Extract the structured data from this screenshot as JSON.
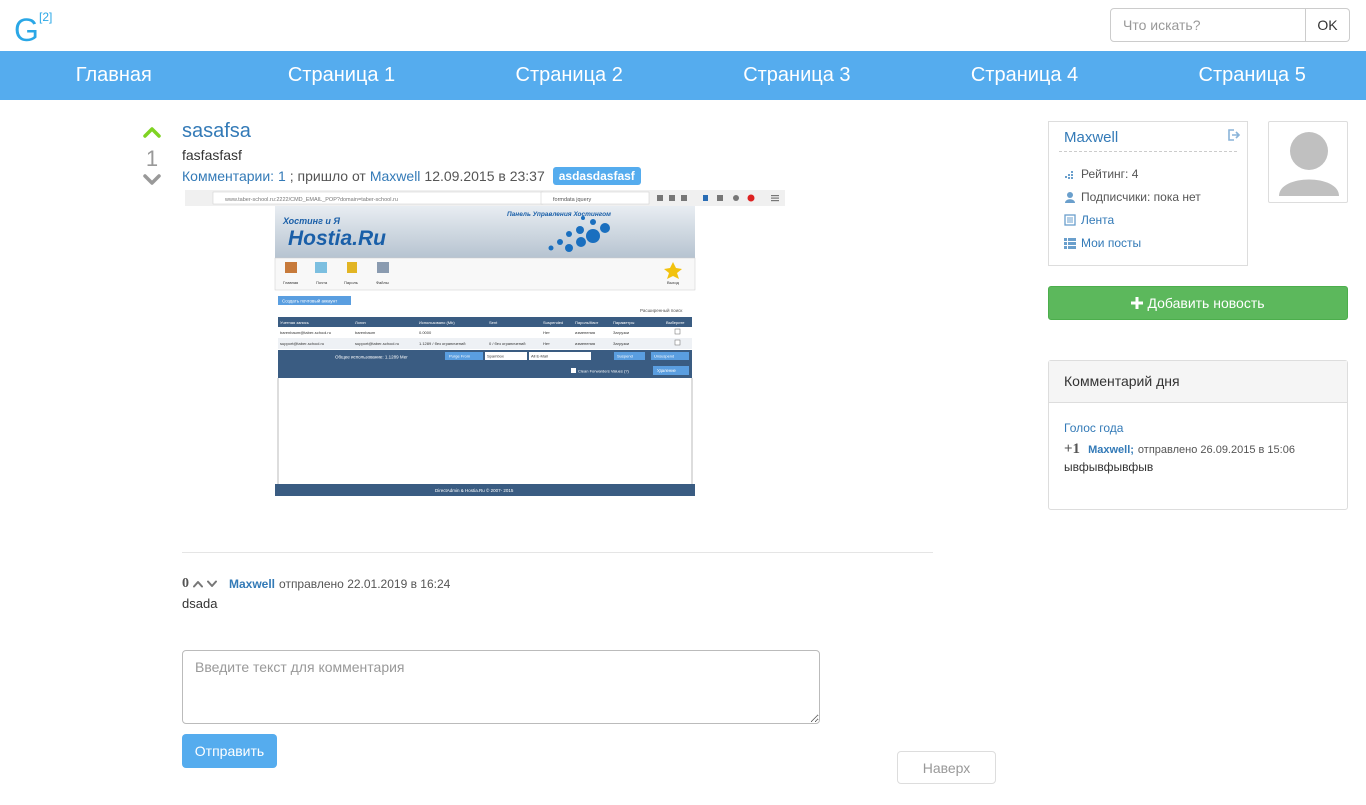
{
  "logo": {
    "letter": "G",
    "superscript": "[2]"
  },
  "search": {
    "placeholder": "Что искать?",
    "button": "OK"
  },
  "nav": [
    "Главная",
    "Страница 1",
    "Страница 2",
    "Страница 3",
    "Страница 4",
    "Страница 5"
  ],
  "post": {
    "score": "1",
    "title": "sasafsa",
    "body": "fasfasfasf",
    "comments_label": "Комментарии: 1",
    "sent_from": "; пришло от",
    "author": "Maxwell",
    "date": "12.09.2015 в 23:37",
    "tag": "asdasdasfasf",
    "screenshot": {
      "url": "www.taber-school.ru:2222/CMD_EMAIL_POP?domain=taber-school.ru",
      "search": "formdata jquery",
      "brand": "Hostia.Ru",
      "brand_tagline": "Хостинг и Я",
      "panel_title": "Панель Управления Хостингом",
      "toolbar": [
        "Главная",
        "Почта",
        "Пароль",
        "Файлы",
        "Выход"
      ],
      "create_btn": "Создать почтовый аккаунт",
      "advanced": "Расширенный поиск",
      "columns": [
        "Учетная запись",
        "Логин",
        "Использовано (Mb)",
        "Sent",
        "Suspended",
        "Пароль/Квот",
        "Параметры",
        "Выберите"
      ],
      "rows": [
        [
          "barenbaum@taber-school.ru",
          "barenbaum",
          "0.0000",
          "",
          "Нет",
          "изменения",
          "Загрузки"
        ],
        [
          "support@taber-school.ru",
          "support@taber-school.ru",
          "1.1289 / без ограничений",
          "0 / без ограничений",
          "Нет",
          "изменения",
          "Загрузки"
        ]
      ],
      "total": "Общее использование: 1.1289 Мег",
      "purge": "Purge From",
      "spambox": "Spambox",
      "all_email": "All E-Mail",
      "suspend": "Suspend",
      "unsuspend": "Unsuspend",
      "clean": "Clean Forwarders Values (?)",
      "delete": "Удаление",
      "footer": "DirectAdmin & Hostia.Ru © 2007- 2015"
    }
  },
  "comment": {
    "score": "0",
    "author": "Maxwell",
    "sent": "отправлено 22.01.2019 в 16:24",
    "text": "dsada"
  },
  "form": {
    "placeholder": "Введите текст для комментария",
    "submit": "Отправить",
    "top": "Наверх"
  },
  "sidebar": {
    "username": "Maxwell",
    "rating": "Рейтинг: 4",
    "subscribers": "Подписчики: пока нет",
    "feed": "Лента",
    "my_posts": "Мои посты",
    "add_news": "Добавить новость",
    "cod_title": "Комментарий дня",
    "cod_link": "Голос года",
    "cod_plus": "+1",
    "cod_author": "Maxwell;",
    "cod_sent": "отправлено 26.09.2015 в 15:06",
    "cod_text": "ывфывфывфыв"
  }
}
